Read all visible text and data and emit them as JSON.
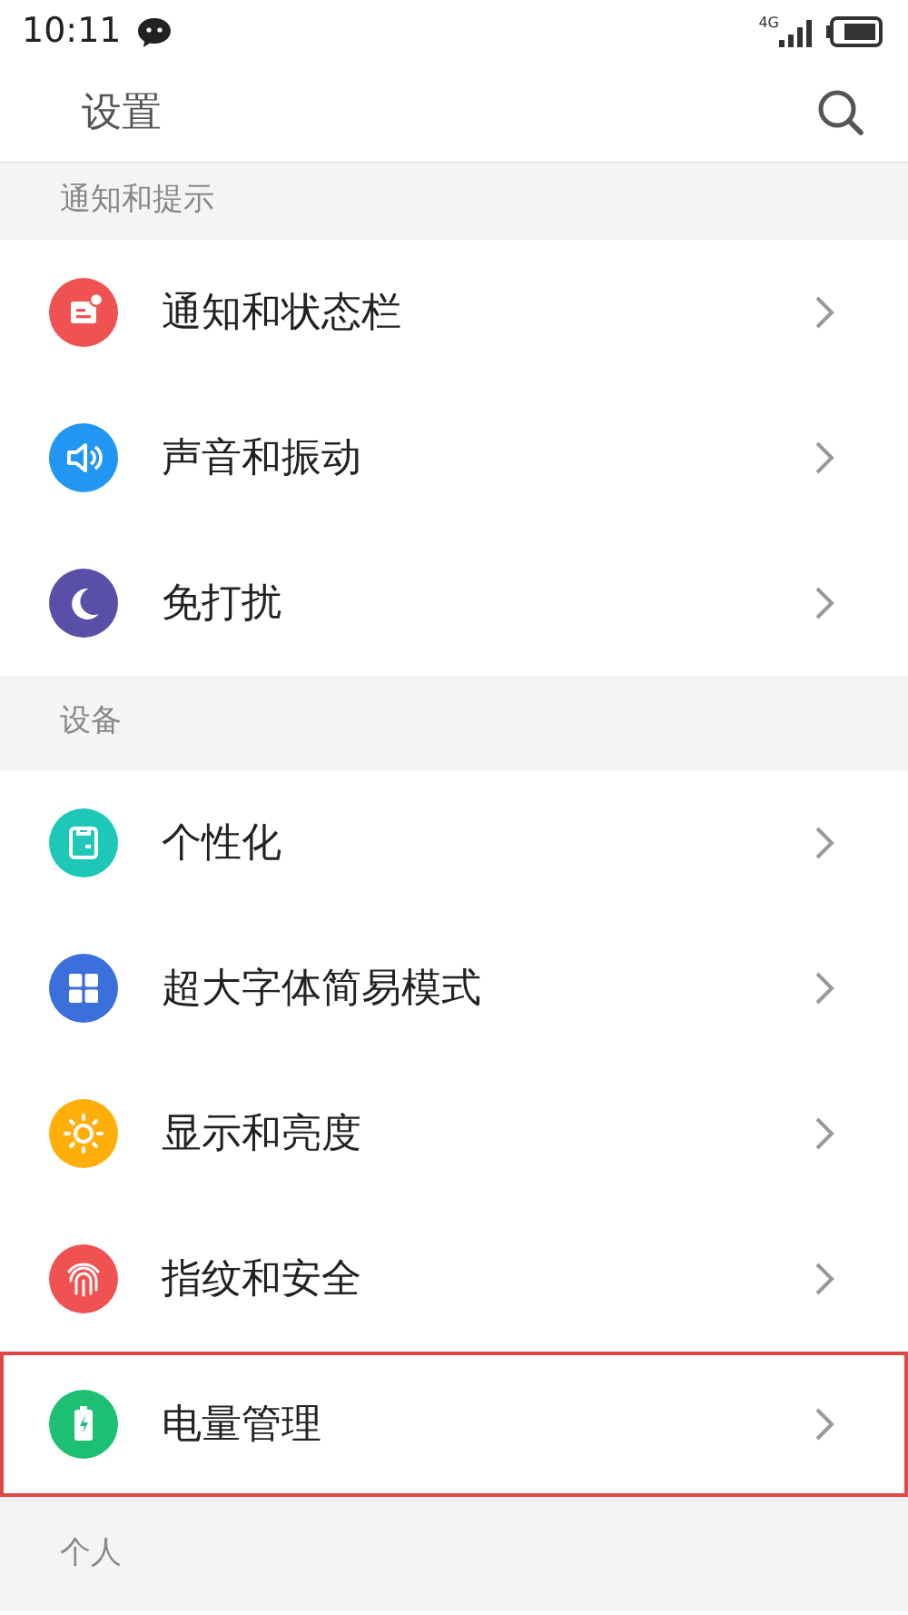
{
  "status_bar": {
    "time": "10:11",
    "network": "4G"
  },
  "header": {
    "title": "设置"
  },
  "sections": [
    {
      "title": "通知和提示",
      "items": [
        {
          "label": "通知和状态栏",
          "kind": "card",
          "color": "#f05252",
          "highlighted": false
        },
        {
          "label": "声音和振动",
          "kind": "speaker",
          "color": "#2196f3",
          "highlighted": false
        },
        {
          "label": "免打扰",
          "kind": "moon",
          "color": "#5a4fa8",
          "highlighted": false
        }
      ]
    },
    {
      "title": "设备",
      "items": [
        {
          "label": "个性化",
          "kind": "shirt",
          "color": "#1ec8b8",
          "highlighted": false
        },
        {
          "label": "超大字体简易模式",
          "kind": "grid",
          "color": "#3a6fdc",
          "highlighted": false
        },
        {
          "label": "显示和亮度",
          "kind": "sun",
          "color": "#ffae0a",
          "highlighted": false
        },
        {
          "label": "指纹和安全",
          "kind": "fingerprint",
          "color": "#f05252",
          "highlighted": false
        },
        {
          "label": "电量管理",
          "kind": "battery",
          "color": "#1dbf73",
          "highlighted": true
        }
      ]
    },
    {
      "title": "个人"
    }
  ]
}
